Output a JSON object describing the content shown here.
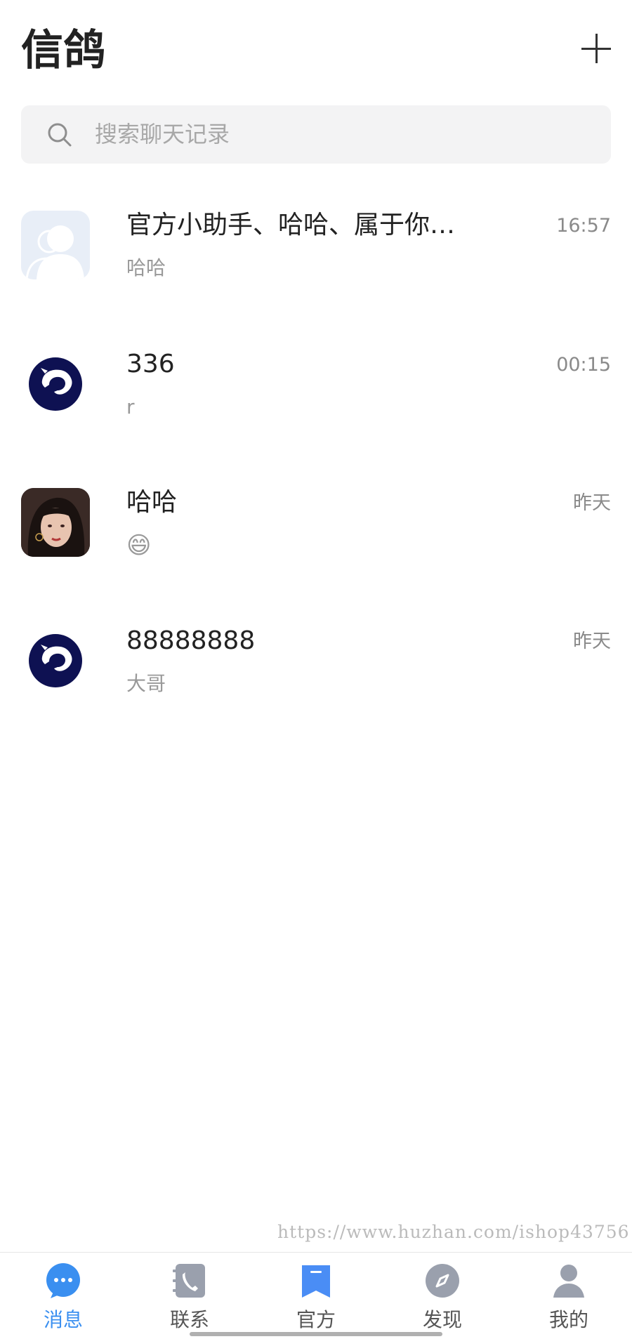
{
  "header": {
    "title": "信鸽",
    "add_icon": "plus-icon"
  },
  "search": {
    "placeholder": "搜索聊天记录",
    "icon": "search-icon"
  },
  "chats": [
    {
      "name": "官方小助手、哈哈、属于你…",
      "time": "16:57",
      "preview": "哈哈",
      "avatar": "group-avatar"
    },
    {
      "name": "336",
      "time": "00:15",
      "preview": "r",
      "avatar": "dog-logo-avatar"
    },
    {
      "name": "哈哈",
      "time": "昨天",
      "preview": "😄",
      "avatar": "photo-avatar"
    },
    {
      "name": "88888888",
      "time": "昨天",
      "preview": "大哥",
      "avatar": "dog-logo-avatar"
    }
  ],
  "watermark": "https://www.huzhan.com/ishop43756",
  "tabs": [
    {
      "label": "消息",
      "icon": "message-icon",
      "active": true
    },
    {
      "label": "联系",
      "icon": "contacts-icon",
      "active": false
    },
    {
      "label": "官方",
      "icon": "official-icon",
      "active": false
    },
    {
      "label": "发现",
      "icon": "compass-icon",
      "active": false
    },
    {
      "label": "我的",
      "icon": "profile-icon",
      "active": false
    }
  ],
  "colors": {
    "accent": "#3a8ff0",
    "tab_icon_gray": "#9aa0ad",
    "brand_navy": "#0e1152"
  }
}
